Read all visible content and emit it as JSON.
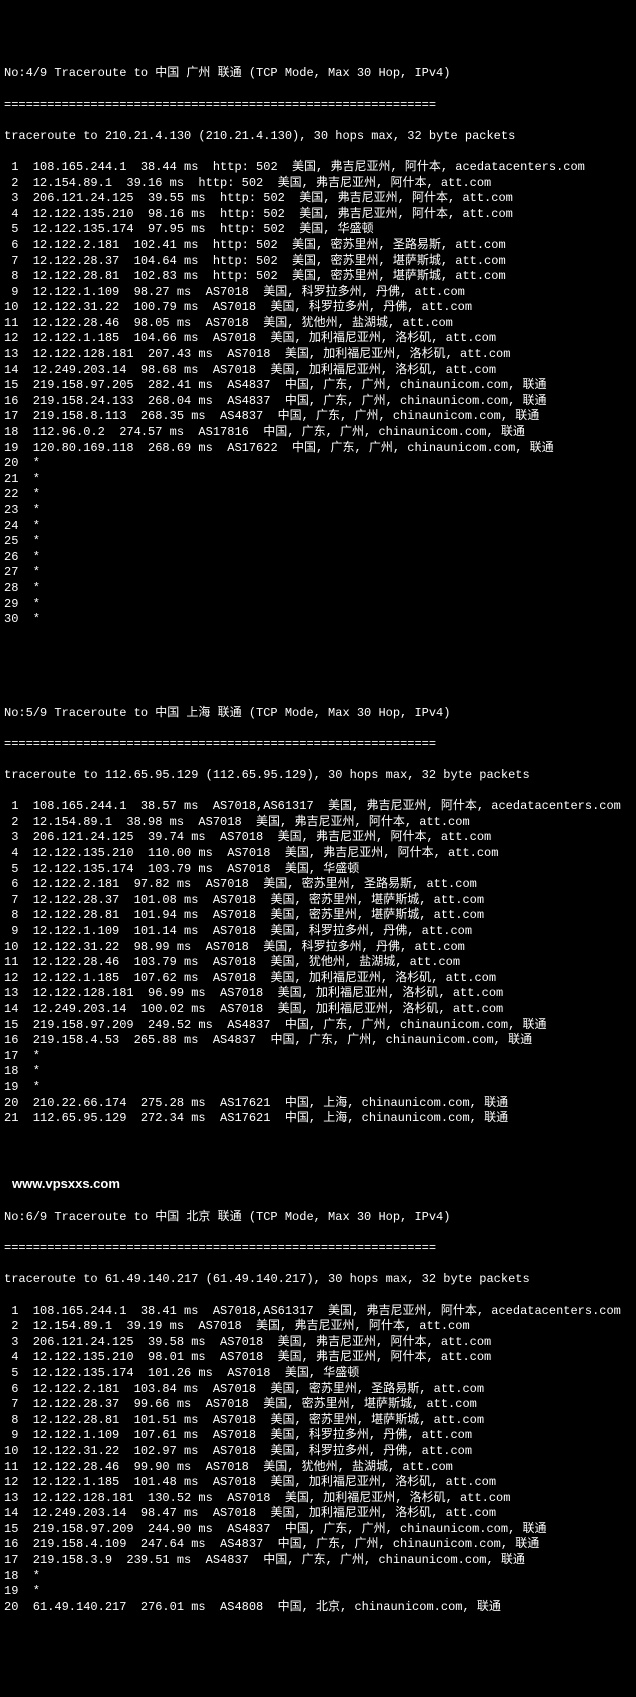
{
  "block4": {
    "header": "No:4/9 Traceroute to 中国 广州 联通 (TCP Mode, Max 30 Hop, IPv4)",
    "separator": "============================================================",
    "direction": "traceroute to 210.21.4.130 (210.21.4.130), 30 hops max, 32 byte packets",
    "hops": [
      " 1  108.165.244.1  38.44 ms  http: 502  美国, 弗吉尼亚州, 阿什本, acedatacenters.com",
      " 2  12.154.89.1  39.16 ms  http: 502  美国, 弗吉尼亚州, 阿什本, att.com",
      " 3  206.121.24.125  39.55 ms  http: 502  美国, 弗吉尼亚州, 阿什本, att.com",
      " 4  12.122.135.210  98.16 ms  http: 502  美国, 弗吉尼亚州, 阿什本, att.com",
      " 5  12.122.135.174  97.95 ms  http: 502  美国, 华盛顿",
      " 6  12.122.2.181  102.41 ms  http: 502  美国, 密苏里州, 圣路易斯, att.com",
      " 7  12.122.28.37  104.64 ms  http: 502  美国, 密苏里州, 堪萨斯城, att.com",
      " 8  12.122.28.81  102.83 ms  http: 502  美国, 密苏里州, 堪萨斯城, att.com",
      " 9  12.122.1.109  98.27 ms  AS7018  美国, 科罗拉多州, 丹佛, att.com",
      "10  12.122.31.22  100.79 ms  AS7018  美国, 科罗拉多州, 丹佛, att.com",
      "11  12.122.28.46  98.05 ms  AS7018  美国, 犹他州, 盐湖城, att.com",
      "12  12.122.1.185  104.66 ms  AS7018  美国, 加利福尼亚州, 洛杉矶, att.com",
      "13  12.122.128.181  207.43 ms  AS7018  美国, 加利福尼亚州, 洛杉矶, att.com",
      "14  12.249.203.14  98.68 ms  AS7018  美国, 加利福尼亚州, 洛杉矶, att.com",
      "15  219.158.97.205  282.41 ms  AS4837  中国, 广东, 广州, chinaunicom.com, 联通",
      "16  219.158.24.133  268.04 ms  AS4837  中国, 广东, 广州, chinaunicom.com, 联通",
      "17  219.158.8.113  268.35 ms  AS4837  中国, 广东, 广州, chinaunicom.com, 联通",
      "18  112.96.0.2  274.57 ms  AS17816  中国, 广东, 广州, chinaunicom.com, 联通",
      "19  120.80.169.118  268.69 ms  AS17622  中国, 广东, 广州, chinaunicom.com, 联通",
      "20  *",
      "21  *",
      "22  *",
      "23  *",
      "24  *",
      "25  *",
      "26  *",
      "27  *",
      "28  *",
      "29  *",
      "30  *"
    ]
  },
  "block5": {
    "header": "No:5/9 Traceroute to 中国 上海 联通 (TCP Mode, Max 30 Hop, IPv4)",
    "separator": "============================================================",
    "direction": "traceroute to 112.65.95.129 (112.65.95.129), 30 hops max, 32 byte packets",
    "hops": [
      " 1  108.165.244.1  38.57 ms  AS7018,AS61317  美国, 弗吉尼亚州, 阿什本, acedatacenters.com",
      " 2  12.154.89.1  38.98 ms  AS7018  美国, 弗吉尼亚州, 阿什本, att.com",
      " 3  206.121.24.125  39.74 ms  AS7018  美国, 弗吉尼亚州, 阿什本, att.com",
      " 4  12.122.135.210  110.00 ms  AS7018  美国, 弗吉尼亚州, 阿什本, att.com",
      " 5  12.122.135.174  103.79 ms  AS7018  美国, 华盛顿",
      " 6  12.122.2.181  97.82 ms  AS7018  美国, 密苏里州, 圣路易斯, att.com",
      " 7  12.122.28.37  101.08 ms  AS7018  美国, 密苏里州, 堪萨斯城, att.com",
      " 8  12.122.28.81  101.94 ms  AS7018  美国, 密苏里州, 堪萨斯城, att.com",
      " 9  12.122.1.109  101.14 ms  AS7018  美国, 科罗拉多州, 丹佛, att.com",
      "10  12.122.31.22  98.99 ms  AS7018  美国, 科罗拉多州, 丹佛, att.com",
      "11  12.122.28.46  103.79 ms  AS7018  美国, 犹他州, 盐湖城, att.com",
      "12  12.122.1.185  107.62 ms  AS7018  美国, 加利福尼亚州, 洛杉矶, att.com",
      "13  12.122.128.181  96.99 ms  AS7018  美国, 加利福尼亚州, 洛杉矶, att.com",
      "14  12.249.203.14  100.02 ms  AS7018  美国, 加利福尼亚州, 洛杉矶, att.com",
      "15  219.158.97.209  249.52 ms  AS4837  中国, 广东, 广州, chinaunicom.com, 联通",
      "16  219.158.4.53  265.88 ms  AS4837  中国, 广东, 广州, chinaunicom.com, 联通",
      "17  *",
      "18  *",
      "19  *",
      "20  210.22.66.174  275.28 ms  AS17621  中国, 上海, chinaunicom.com, 联通",
      "21  112.65.95.129  272.34 ms  AS17621  中国, 上海, chinaunicom.com, 联通"
    ]
  },
  "watermark": "www.vpsxxs.com",
  "block6": {
    "header": "No:6/9 Traceroute to 中国 北京 联通 (TCP Mode, Max 30 Hop, IPv4)",
    "separator": "============================================================",
    "direction": "traceroute to 61.49.140.217 (61.49.140.217), 30 hops max, 32 byte packets",
    "hops": [
      " 1  108.165.244.1  38.41 ms  AS7018,AS61317  美国, 弗吉尼亚州, 阿什本, acedatacenters.com",
      " 2  12.154.89.1  39.19 ms  AS7018  美国, 弗吉尼亚州, 阿什本, att.com",
      " 3  206.121.24.125  39.58 ms  AS7018  美国, 弗吉尼亚州, 阿什本, att.com",
      " 4  12.122.135.210  98.01 ms  AS7018  美国, 弗吉尼亚州, 阿什本, att.com",
      " 5  12.122.135.174  101.26 ms  AS7018  美国, 华盛顿",
      " 6  12.122.2.181  103.84 ms  AS7018  美国, 密苏里州, 圣路易斯, att.com",
      " 7  12.122.28.37  99.66 ms  AS7018  美国, 密苏里州, 堪萨斯城, att.com",
      " 8  12.122.28.81  101.51 ms  AS7018  美国, 密苏里州, 堪萨斯城, att.com",
      " 9  12.122.1.109  107.61 ms  AS7018  美国, 科罗拉多州, 丹佛, att.com",
      "10  12.122.31.22  102.97 ms  AS7018  美国, 科罗拉多州, 丹佛, att.com",
      "11  12.122.28.46  99.90 ms  AS7018  美国, 犹他州, 盐湖城, att.com",
      "12  12.122.1.185  101.48 ms  AS7018  美国, 加利福尼亚州, 洛杉矶, att.com",
      "13  12.122.128.181  130.52 ms  AS7018  美国, 加利福尼亚州, 洛杉矶, att.com",
      "14  12.249.203.14  98.47 ms  AS7018  美国, 加利福尼亚州, 洛杉矶, att.com",
      "15  219.158.97.209  244.90 ms  AS4837  中国, 广东, 广州, chinaunicom.com, 联通",
      "16  219.158.4.109  247.64 ms  AS4837  中国, 广东, 广州, chinaunicom.com, 联通",
      "17  219.158.3.9  239.51 ms  AS4837  中国, 广东, 广州, chinaunicom.com, 联通",
      "18  *",
      "19  *",
      "20  61.49.140.217  276.01 ms  AS4808  中国, 北京, chinaunicom.com, 联通"
    ]
  }
}
